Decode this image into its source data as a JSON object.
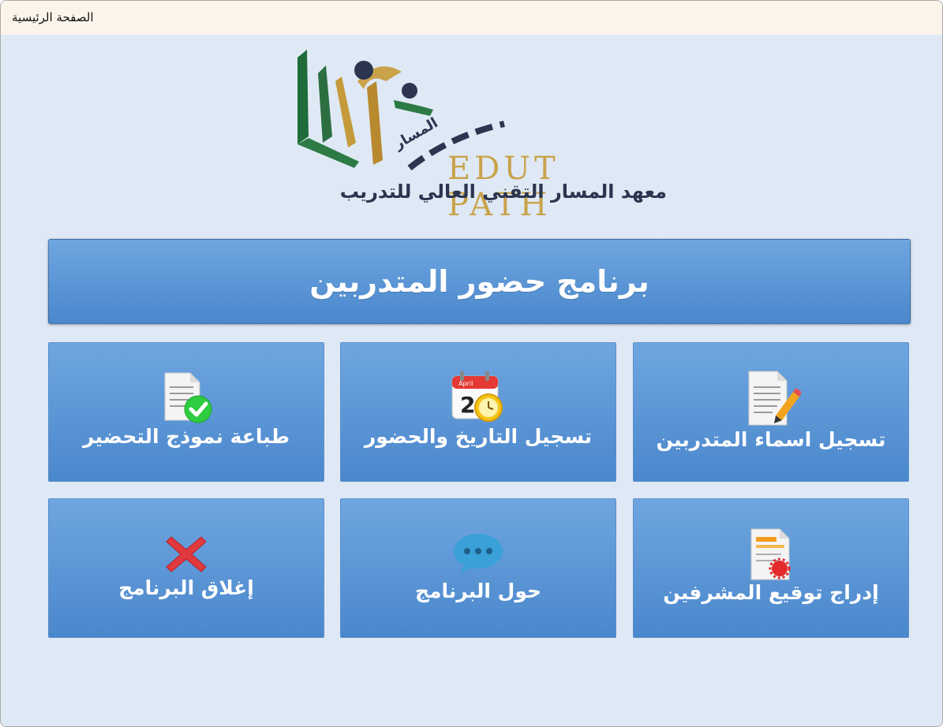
{
  "window": {
    "title": "الصفحة الرئيسية"
  },
  "logo": {
    "name": "EDUT PATH",
    "arabic_mark": "المسار",
    "tagline": "معهد المسار التقني العالي للتدريب"
  },
  "header": {
    "title": "برنامج حضور المتدربين"
  },
  "tiles": [
    {
      "label": "تسجيل اسماء المتدربين",
      "icon": "document-pencil-icon"
    },
    {
      "label": "تسجيل التاريخ والحضور",
      "icon": "calendar-clock-icon",
      "icon_text": {
        "month": "April",
        "day": "2"
      }
    },
    {
      "label": "طباعة نموذج التحضير",
      "icon": "document-check-icon"
    },
    {
      "label": "إدراج توقيع المشرفين",
      "icon": "certificate-seal-icon"
    },
    {
      "label": "حول البرنامج",
      "icon": "speech-bubble-icon"
    },
    {
      "label": "إغلاق البرنامج",
      "icon": "red-x-icon"
    }
  ],
  "colors": {
    "accent": "#4a87cc",
    "accent_light": "#6fa6e0",
    "background": "#dfe9f5",
    "titlebar": "#fbf4ea"
  }
}
